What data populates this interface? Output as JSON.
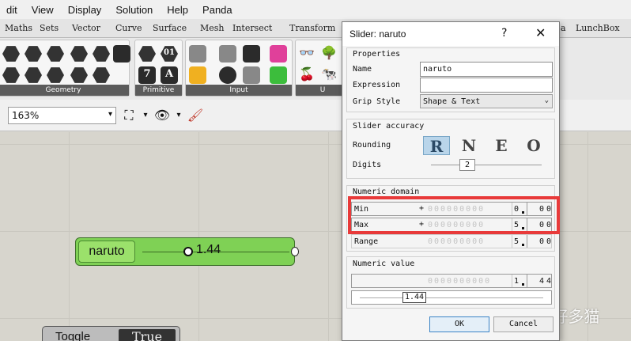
{
  "menubar": {
    "items": [
      "dit",
      "View",
      "Display",
      "Solution",
      "Help",
      "Panda"
    ]
  },
  "tabs": [
    "Maths",
    "Sets",
    "Vector",
    "Curve",
    "Surface",
    "Mesh",
    "Intersect",
    "Transform",
    "a",
    "LunchBox"
  ],
  "ribbon": {
    "panels": [
      "Geometry",
      "Primitive",
      "Input",
      "U"
    ]
  },
  "toolbar": {
    "zoom": "163%"
  },
  "canvas": {
    "slider": {
      "name": "naruto",
      "value": "1.44",
      "position": 0.288
    },
    "toggle": {
      "label": "Toggle",
      "value": "True"
    }
  },
  "dialog": {
    "title": "Slider: naruto",
    "help": "?",
    "close": "✕",
    "properties": {
      "heading": "Properties",
      "name_label": "Name",
      "name_value": "naruto",
      "expression_label": "Expression",
      "expression_value": "",
      "grip_label": "Grip Style",
      "grip_value": "Shape & Text"
    },
    "accuracy": {
      "heading": "Slider accuracy",
      "rounding_label": "Rounding",
      "rounding_options": [
        "R",
        "N",
        "E",
        "O"
      ],
      "rounding_selected": "R",
      "digits_label": "Digits",
      "digits_value": "2"
    },
    "domain": {
      "heading": "Numeric domain",
      "min_label": "Min",
      "min_int": "0",
      "min_dec": "00",
      "max_label": "Max",
      "max_int": "5",
      "max_dec": "00",
      "range_label": "Range",
      "range_int": "5",
      "range_dec": "00",
      "sign": "+",
      "placeholder_digits": "000000000"
    },
    "numeric_value": {
      "heading": "Numeric value",
      "int": "1",
      "dec": "44",
      "placeholder_digits": "0000000000",
      "slider_value": "1.44"
    },
    "ok": "OK",
    "cancel": "Cancel"
  },
  "watermark": "知乎 @好多猫",
  "colors": {
    "component_green": "#7fd155",
    "highlight": "#e83a3a",
    "accent": "#3b84c6"
  }
}
